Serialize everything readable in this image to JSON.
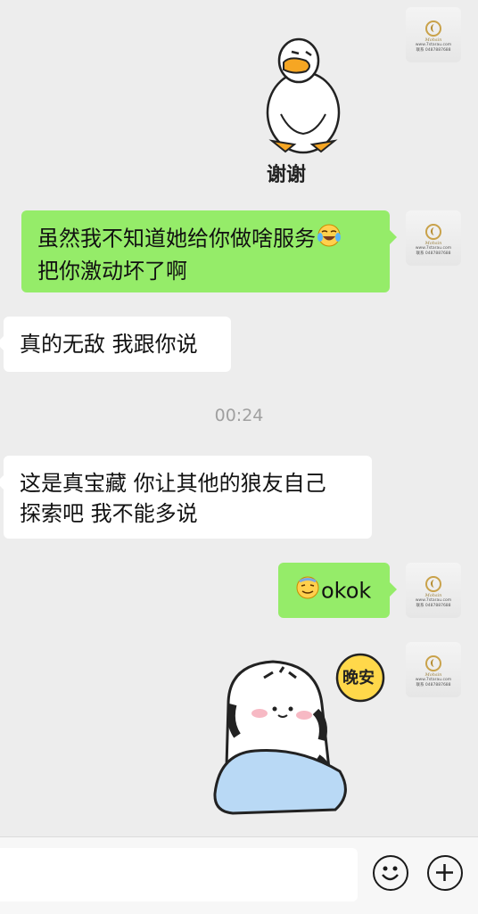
{
  "messages": {
    "m1": {
      "side": "right",
      "type": "sticker",
      "sticker": "duck-thanks-sticker",
      "caption": "谢谢"
    },
    "m2": {
      "side": "right",
      "type": "text",
      "line1": "虽然我不知道她给你做啥服务",
      "line2": "把你激动坏了啊",
      "emoji": "tears-of-joy-emoji"
    },
    "m3": {
      "side": "left",
      "type": "text",
      "line1": "真的无敌 我跟你说"
    },
    "m4": {
      "side": "left",
      "type": "text",
      "line1": "这是真宝藏 你让其他的狼友自己",
      "line2": "探索吧 我不能多说"
    },
    "m5": {
      "side": "right",
      "type": "text",
      "line1": "okok",
      "emoji": "sweat-smile-emoji"
    },
    "m6": {
      "side": "right",
      "type": "sticker",
      "sticker": "cat-goodnight-sticker",
      "caption": "晚安"
    }
  },
  "timestamp": "00:24",
  "avatar": {
    "brand": "Mohsin",
    "line1": "www.7starau.com",
    "line2": "联系 0487887688"
  },
  "bottom_bar": {
    "input_value": "",
    "emoji_button": "smiley-icon",
    "plus_button": "plus-icon"
  },
  "colors": {
    "background": "#ededed",
    "self_bubble": "#95ec69",
    "other_bubble": "#ffffff",
    "timestamp": "#a0a0a0"
  }
}
